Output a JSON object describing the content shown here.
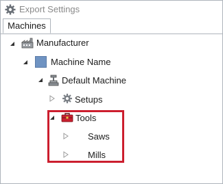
{
  "window": {
    "title": "Export Settings",
    "title_icon": "gear-icon"
  },
  "tabs": [
    {
      "label": "Machines",
      "selected": true
    }
  ],
  "tree": {
    "manufacturer": {
      "label": "Manufacturer",
      "expanded": true,
      "icon": "factory-icon"
    },
    "machine_name": {
      "label": "Machine Name",
      "expanded": true,
      "icon": "machine-swatch-icon"
    },
    "default_machine": {
      "label": "Default Machine",
      "expanded": true,
      "icon": "machine-icon"
    },
    "setups": {
      "label": "Setups",
      "expanded": false,
      "icon": "gear-icon"
    },
    "tools": {
      "label": "Tools",
      "expanded": true,
      "icon": "toolbox-icon"
    },
    "saws": {
      "label": "Saws",
      "expanded": false
    },
    "mills": {
      "label": "Mills",
      "expanded": false
    }
  },
  "colors": {
    "highlight": "#cc1e2e",
    "swatch": "#6f93c2",
    "toolbox": "#c8202f"
  }
}
